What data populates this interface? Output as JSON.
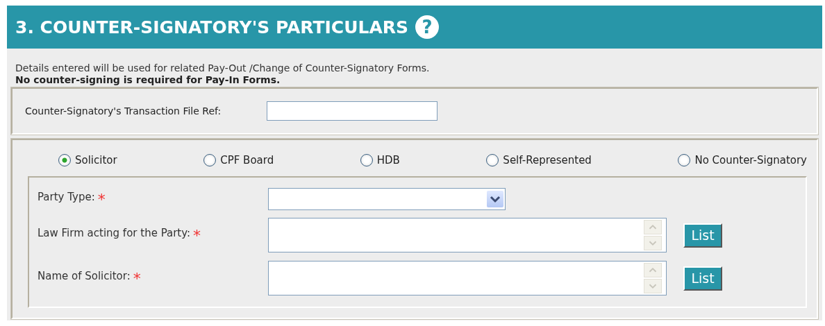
{
  "section": {
    "title": "3. COUNTER-SIGNATORY'S PARTICULARS",
    "help": "?"
  },
  "intro": {
    "line_1": "Details entered will be used for related Pay-Out /Change of Counter-Signatory Forms.",
    "line_2": "No counter-signing is required for Pay-In Forms."
  },
  "file_ref": {
    "label": "Counter-Signatory's Transaction File Ref:"
  },
  "counter_signatory_types": [
    {
      "label": "Solicitor",
      "selected": true
    },
    {
      "label": "CPF Board",
      "selected": false
    },
    {
      "label": "HDB",
      "selected": false
    },
    {
      "label": "Self-Represented",
      "selected": false
    },
    {
      "label": "No Counter-Signatory",
      "selected": false
    }
  ],
  "fields": [
    {
      "kind": "select",
      "label": "Party Type:",
      "required_mark": "*"
    },
    {
      "kind": "textarea",
      "label": "Law Firm acting for the Party:",
      "required_mark": "*",
      "button": "List"
    },
    {
      "kind": "textarea",
      "label": "Name of Solicitor:",
      "required_mark": "*",
      "button": "List"
    }
  ]
}
